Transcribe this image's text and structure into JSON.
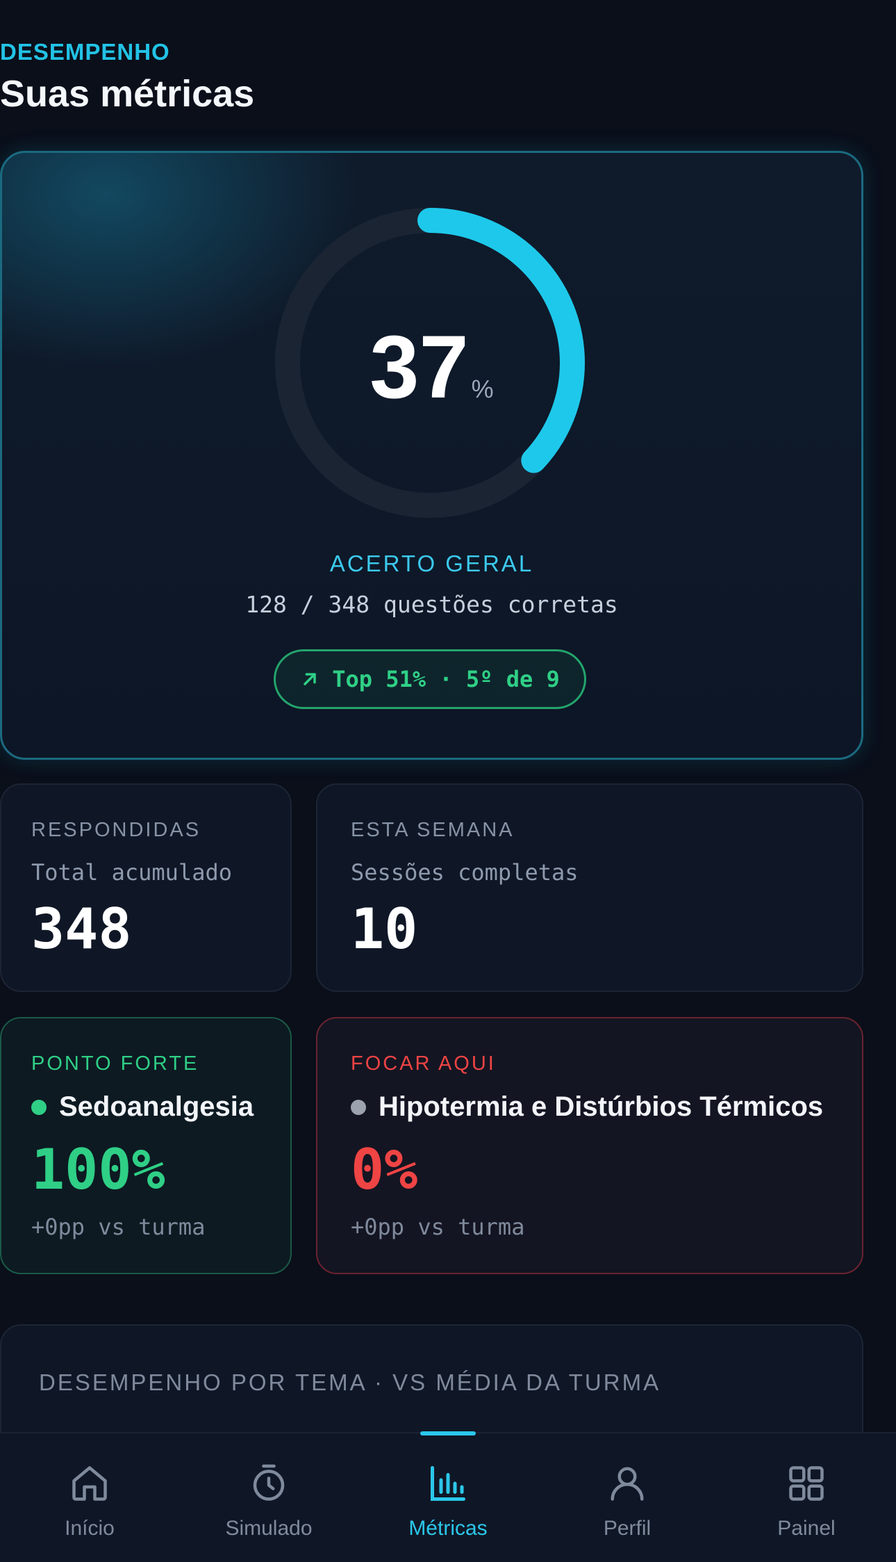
{
  "header": {
    "eyebrow": "DESEMPENHO",
    "title": "Suas métricas"
  },
  "overall": {
    "value": "37",
    "unit": "%",
    "percent": 37,
    "label": "ACERTO GERAL",
    "detail": "128 / 348 questões corretas",
    "rank": "Top 51% · 5º de 9"
  },
  "stats": {
    "answered": {
      "label": "RESPONDIDAS",
      "sub": "Total acumulado",
      "value": "348"
    },
    "week": {
      "label": "ESTA SEMANA",
      "sub": "Sessões completas",
      "value": "10"
    }
  },
  "strong": {
    "label": "PONTO FORTE",
    "topic": "Sedoanalgesia",
    "value": "100%",
    "compare": "+0pp vs turma"
  },
  "focus": {
    "label": "FOCAR AQUI",
    "topic": "Hipotermia e Distúrbios Térmicos",
    "value": "0%",
    "compare": "+0pp vs turma"
  },
  "section": {
    "title": "DESEMPENHO POR TEMA · VS MÉDIA DA TURMA"
  },
  "nav": {
    "items": [
      {
        "label": "Início",
        "icon": "home-icon"
      },
      {
        "label": "Simulado",
        "icon": "timer-icon"
      },
      {
        "label": "Métricas",
        "icon": "bar-chart-icon"
      },
      {
        "label": "Perfil",
        "icon": "user-icon"
      },
      {
        "label": "Painel",
        "icon": "grid-icon"
      }
    ],
    "active": "Métricas"
  },
  "colors": {
    "accent": "#22c3e6",
    "success": "#2fcf86",
    "danger": "#ef4444",
    "background": "#0a0f1a",
    "card": "#0f1726"
  }
}
